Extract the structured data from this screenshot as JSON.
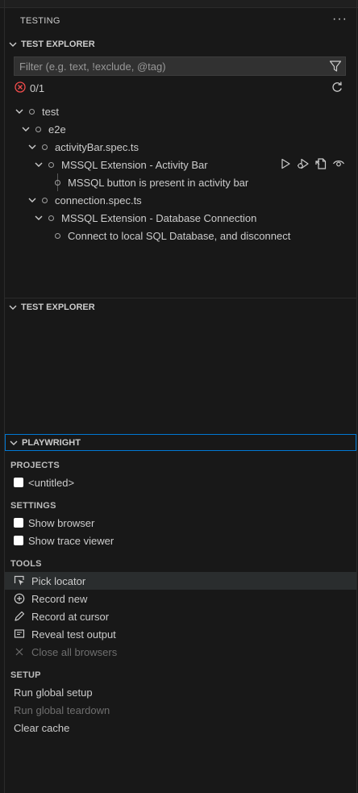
{
  "panel": {
    "title": "TESTING",
    "more_icon": "ellipsis-icon"
  },
  "test_explorer": {
    "header": "TEST EXPLORER",
    "filter": {
      "placeholder": "Filter (e.g. text, !exclude, @tag)",
      "value": ""
    },
    "status": {
      "text": "0/1",
      "icon": "error-icon"
    },
    "tree": [
      {
        "label": "test"
      },
      {
        "label": "e2e"
      },
      {
        "label": "activityBar.spec.ts"
      },
      {
        "label": "MSSQL Extension - Activity Bar"
      },
      {
        "label": "MSSQL button is present in activity bar"
      },
      {
        "label": "connection.spec.ts"
      },
      {
        "label": "MSSQL Extension - Database Connection"
      },
      {
        "label": "Connect to local SQL Database, and disconnect"
      }
    ]
  },
  "test_explorer_2": {
    "header": "TEST EXPLORER"
  },
  "playwright": {
    "header": "PLAYWRIGHT",
    "projects": {
      "label": "PROJECTS",
      "items": [
        {
          "label": "<untitled>",
          "checked": false
        }
      ]
    },
    "settings": {
      "label": "SETTINGS",
      "items": [
        {
          "label": "Show browser",
          "checked": false
        },
        {
          "label": "Show trace viewer",
          "checked": false
        }
      ]
    },
    "tools": {
      "label": "TOOLS",
      "items": [
        {
          "label": "Pick locator",
          "icon": "pick-locator-icon"
        },
        {
          "label": "Record new",
          "icon": "add-circle-icon"
        },
        {
          "label": "Record at cursor",
          "icon": "pencil-icon"
        },
        {
          "label": "Reveal test output",
          "icon": "output-icon"
        },
        {
          "label": "Close all browsers",
          "icon": "close-icon"
        }
      ]
    },
    "setup": {
      "label": "SETUP",
      "items": [
        {
          "label": "Run global setup"
        },
        {
          "label": "Run global teardown"
        },
        {
          "label": "Clear cache"
        }
      ]
    }
  },
  "colors": {
    "background": "#181818",
    "focus_border": "#0078d4",
    "error": "#f14c4c",
    "disabled_text": "#6e6e6e"
  }
}
